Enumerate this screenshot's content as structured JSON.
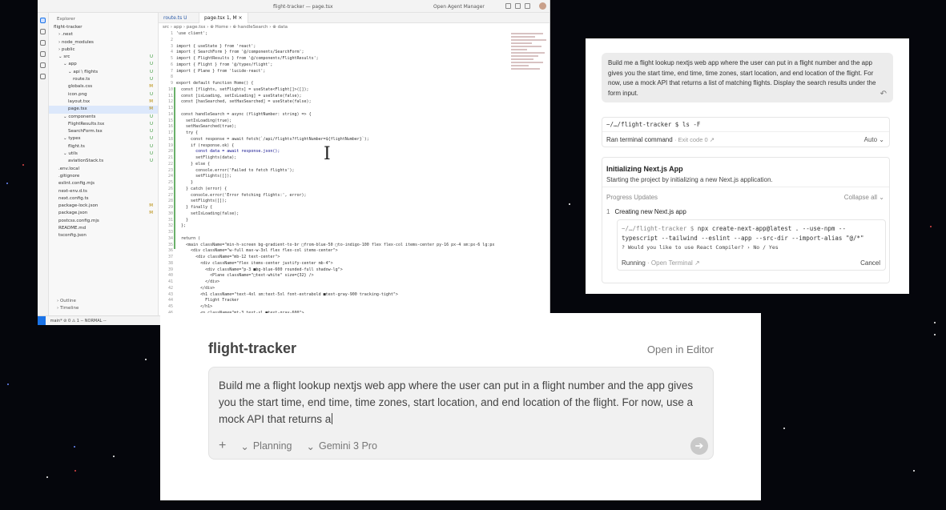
{
  "editor": {
    "window_title": "flight-tracker — page.tsx",
    "agent_manager_label": "Open Agent Manager",
    "explorer_header": "Explorer",
    "tree": [
      {
        "label": "flight-tracker",
        "indent": 0,
        "status": ""
      },
      {
        "label": "› .next",
        "indent": 1,
        "status": ""
      },
      {
        "label": "› node_modules",
        "indent": 1,
        "status": ""
      },
      {
        "label": "› public",
        "indent": 1,
        "status": ""
      },
      {
        "label": "⌄ src",
        "indent": 1,
        "status": "U"
      },
      {
        "label": "⌄ app",
        "indent": 2,
        "status": "U"
      },
      {
        "label": "⌄ api \\ flights",
        "indent": 3,
        "status": "U"
      },
      {
        "label": "route.ts",
        "indent": 4,
        "status": "U"
      },
      {
        "label": "globals.css",
        "indent": 3,
        "status": "M"
      },
      {
        "label": "icon.png",
        "indent": 3,
        "status": "U"
      },
      {
        "label": "layout.tsx",
        "indent": 3,
        "status": "M"
      },
      {
        "label": "page.tsx",
        "indent": 3,
        "status": "M",
        "selected": true
      },
      {
        "label": "⌄ components",
        "indent": 2,
        "status": "U"
      },
      {
        "label": "FlightResults.tsx",
        "indent": 3,
        "status": "U"
      },
      {
        "label": "SearchForm.tsx",
        "indent": 3,
        "status": "U"
      },
      {
        "label": "⌄ types",
        "indent": 2,
        "status": "U"
      },
      {
        "label": "flight.ts",
        "indent": 3,
        "status": "U"
      },
      {
        "label": "⌄ utils",
        "indent": 2,
        "status": "U"
      },
      {
        "label": "aviationStack.ts",
        "indent": 3,
        "status": "U"
      },
      {
        "label": ".env.local",
        "indent": 1,
        "status": ""
      },
      {
        "label": ".gitignore",
        "indent": 1,
        "status": ""
      },
      {
        "label": "eslint.config.mjs",
        "indent": 1,
        "status": ""
      },
      {
        "label": "next-env.d.ts",
        "indent": 1,
        "status": ""
      },
      {
        "label": "next.config.ts",
        "indent": 1,
        "status": ""
      },
      {
        "label": "package-lock.json",
        "indent": 1,
        "status": "M"
      },
      {
        "label": "package.json",
        "indent": 1,
        "status": "M"
      },
      {
        "label": "postcss.config.mjs",
        "indent": 1,
        "status": ""
      },
      {
        "label": "README.md",
        "indent": 1,
        "status": ""
      },
      {
        "label": "tsconfig.json",
        "indent": 1,
        "status": ""
      }
    ],
    "outline_label": "› Outline",
    "timeline_label": "› Timeline",
    "tabs": [
      {
        "label": "route.ts  U",
        "active": false
      },
      {
        "label": "page.tsx  1, M  ×",
        "active": true
      }
    ],
    "breadcrumb": "src › app › page.tsx › ⊕ Home › ⊕ handleSearch › ⊕ data",
    "code_lines": [
      "'use client';",
      "",
      "import { useState } from 'react';",
      "import { SearchForm } from '@/components/SearchForm';",
      "import { FlightResults } from '@/components/FlightResults';",
      "import { Flight } from '@/types/flight';",
      "import { Plane } from 'lucide-react';",
      "",
      "export default function Home() {",
      "  const [flights, setFlights] = useState<Flight[]>([]);",
      "  const [isLoading, setIsLoading] = useState(false);",
      "  const [hasSearched, setHasSearched] = useState(false);",
      "",
      "  const handleSearch = async (flightNumber: string) => {",
      "    setIsLoading(true);",
      "    setHasSearched(true);",
      "    try {",
      "      const response = await fetch(`/api/flights?flightNumber=${flightNumber}`);",
      "      if (response.ok) {",
      "        const data = await response.json();",
      "        setFlights(data);",
      "      } else {",
      "        console.error('Failed to fetch flights');",
      "        setFlights([]);",
      "      }",
      "    } catch (error) {",
      "      console.error('Error fetching flights:', error);",
      "      setFlights([]);",
      "    } finally {",
      "      setIsLoading(false);",
      "    }",
      "  };",
      "",
      "  return (",
      "    <main className=\"min-h-screen bg-gradient-to-br □from-blue-50 □to-indigo-100 flex flex-col items-center py-16 px-4 sm:px-6 lg:px",
      "      <div className=\"w-full max-w-3xl flex flex-col items-center\">",
      "        <div className=\"mb-12 text-center\">",
      "          <div className=\"flex items-center justify-center mb-4\">",
      "            <div className=\"p-3 ■bg-blue-600 rounded-full shadow-lg\">",
      "              <Plane className=\"□text-white\" size={32} />",
      "            </div>",
      "          </div>",
      "          <h1 className=\"text-4xl sm:text-5xl font-extrabold ■text-gray-900 tracking-tight\">",
      "            Flight Tracker",
      "          </h1>",
      "          <p className=\"mt-3 text-xl ■text-gray-600\">"
    ],
    "line_start": 1,
    "status_bar": "main*   ⊘ 0 ⚠ 1   -- NORMAL --"
  },
  "agent": {
    "prompt": "Build me a flight lookup nextjs web app where the user can put in a flight number and the app gives you the start time, end time, time zones, start location, and end location of the flight. For now, use a mock API that returns a list of matching flights. Display the search results under the form input.",
    "command": "~/…/flight-tracker $ ls -F",
    "ran_label": "Ran terminal command",
    "exit_label": "· Exit code 0 ↗",
    "auto_label": "Auto ⌄",
    "init_title": "Initializing Next.js App",
    "init_subtitle": "Starting the project by initializing a new Next.js application.",
    "progress_label": "Progress Updates",
    "collapse_label": "Collapse all ⌄",
    "step_number": "1",
    "step_label": "Creating new Next.js app",
    "term_prompt": "~/…/flight-tracker $",
    "term_command": "npx create-next-app@latest . --use-npm --typescript --tailwind --eslint --app --src-dir --import-alias \"@/*\"",
    "term_question": "? Would you like to use React Compiler? › No / Yes",
    "running_label": "Running",
    "open_terminal_label": "· Open Terminal ↗",
    "cancel_label": "Cancel"
  },
  "panel": {
    "title": "flight-tracker",
    "open_in_editor": "Open in Editor",
    "input_text": "Build me a flight lookup nextjs web app where the user can put in a flight number and the app gives you the start time, end time, time zones, start location, and end location of the flight. For now, use a mock API that returns a",
    "add_icon": "+",
    "mode_label": "Planning",
    "model_label": "Gemini 3 Pro",
    "send_icon": "➔"
  }
}
